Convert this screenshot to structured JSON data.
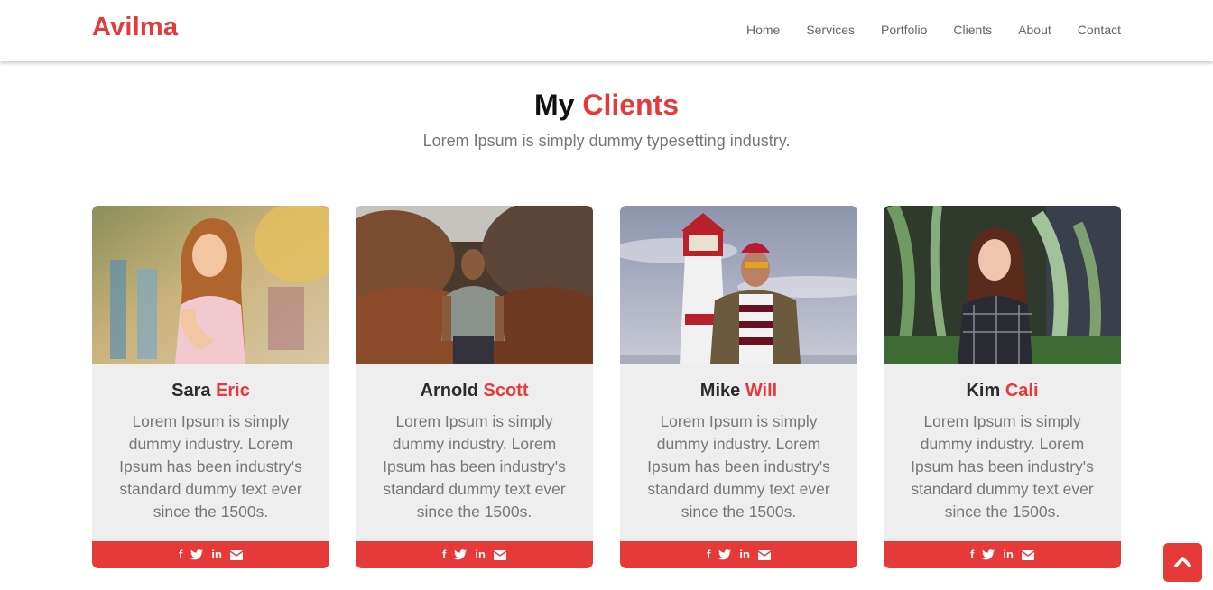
{
  "brand": "Avilma",
  "nav": {
    "items": [
      "Home",
      "Services",
      "Portfolio",
      "Clients",
      "About",
      "Contact"
    ]
  },
  "section": {
    "title_first": "My",
    "title_accent": "Clients",
    "subtitle": "Lorem Ipsum is simply dummy typesetting industry."
  },
  "clients": [
    {
      "first": "Sara",
      "last": "Eric",
      "text": "Lorem Ipsum is simply dummy industry. Lorem Ipsum has been industry's standard dummy text ever since the 1500s."
    },
    {
      "first": "Arnold",
      "last": "Scott",
      "text": "Lorem Ipsum is simply dummy industry. Lorem Ipsum has been industry's standard dummy text ever since the 1500s."
    },
    {
      "first": "Mike",
      "last": "Will",
      "text": "Lorem Ipsum is simply dummy industry. Lorem Ipsum has been industry's standard dummy text ever since the 1500s."
    },
    {
      "first": "Kim",
      "last": "Cali",
      "text": "Lorem Ipsum is simply dummy industry. Lorem Ipsum has been industry's standard dummy text ever since the 1500s."
    }
  ],
  "social_icons": [
    "facebook-icon",
    "twitter-icon",
    "linkedin-icon",
    "envelope-icon"
  ],
  "social_glyphs": {
    "facebook": "f",
    "twitter": "t",
    "linkedin": "in"
  },
  "colors": {
    "accent": "#e5393a",
    "card_bg": "#eeeeee",
    "text_muted": "#777777"
  }
}
